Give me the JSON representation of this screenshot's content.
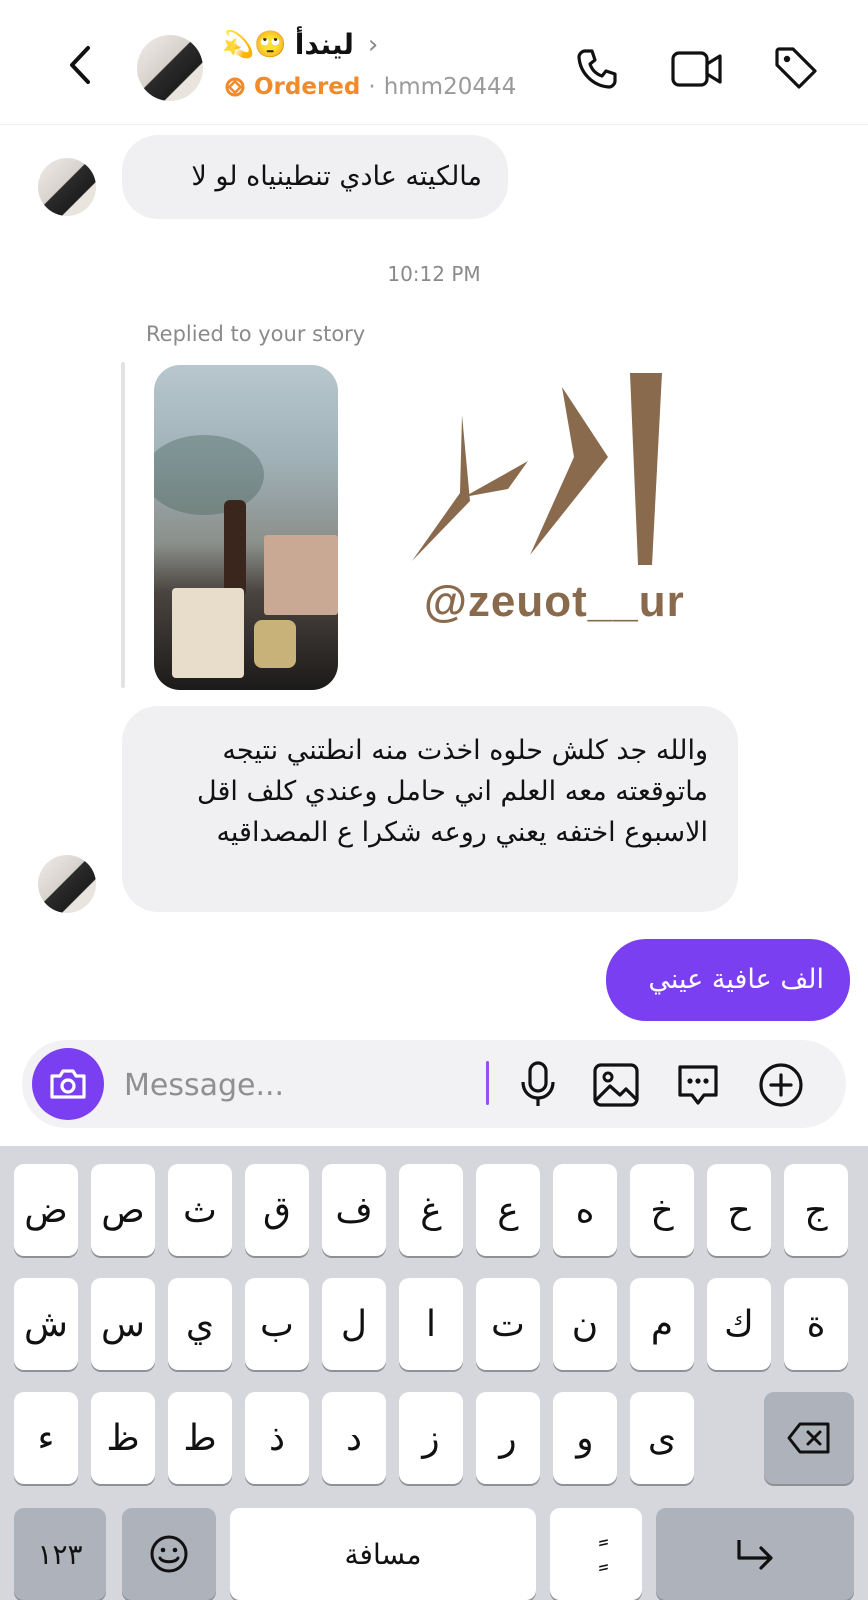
{
  "header": {
    "back_icon": "chevron-left-icon",
    "contact_name": "ليندأ",
    "contact_emojis": "💫🙄",
    "ordered_label": "Ordered",
    "separator": "·",
    "username": "hmm20444",
    "call_icon": "phone-icon",
    "video_icon": "video-camera-icon",
    "label_icon": "tag-icon"
  },
  "messages": {
    "msg1": "مالكيته عادي تنطينياه لو لا",
    "timestamp": "10:12 PM",
    "replied_label": "Replied to your story",
    "story_overlay_handle": "@zeuot__ur",
    "msg2": "والله جد كلش حلوه اخذت منه انطتني نتيجه ماتوقعته معه العلم اني حامل وعندي كلف اقل الاسبوع اختفه يعني روعه شكرا ع المصداقيه",
    "msg_out": "الف عافية عيني"
  },
  "composer": {
    "placeholder": "Message...",
    "camera_icon": "camera-icon",
    "mic_icon": "microphone-icon",
    "gallery_icon": "image-icon",
    "sticker_icon": "chat-bubble-dots-icon",
    "plus_icon": "plus-circle-icon"
  },
  "keyboard": {
    "row1": [
      "ض",
      "ص",
      "ث",
      "ق",
      "ف",
      "غ",
      "ع",
      "ه",
      "خ",
      "ح",
      "ج"
    ],
    "row2": [
      "ش",
      "س",
      "ي",
      "ب",
      "ل",
      "ا",
      "ت",
      "ن",
      "م",
      "ك",
      "ة"
    ],
    "row3": [
      "ء",
      "ظ",
      "ط",
      "ذ",
      "د",
      "ز",
      "ر",
      "و",
      "ى"
    ],
    "numbers_key": "١٢٣",
    "space_key": "مسافة",
    "diacritic_key": "ًٍ",
    "emoji_icon": "emoji-icon",
    "delete_icon": "backspace-icon",
    "return_icon": "return-arrow-icon"
  },
  "colors": {
    "accent": "#7b3ff2",
    "ordered": "#f08a2a",
    "brand": "#8a6a4c"
  }
}
